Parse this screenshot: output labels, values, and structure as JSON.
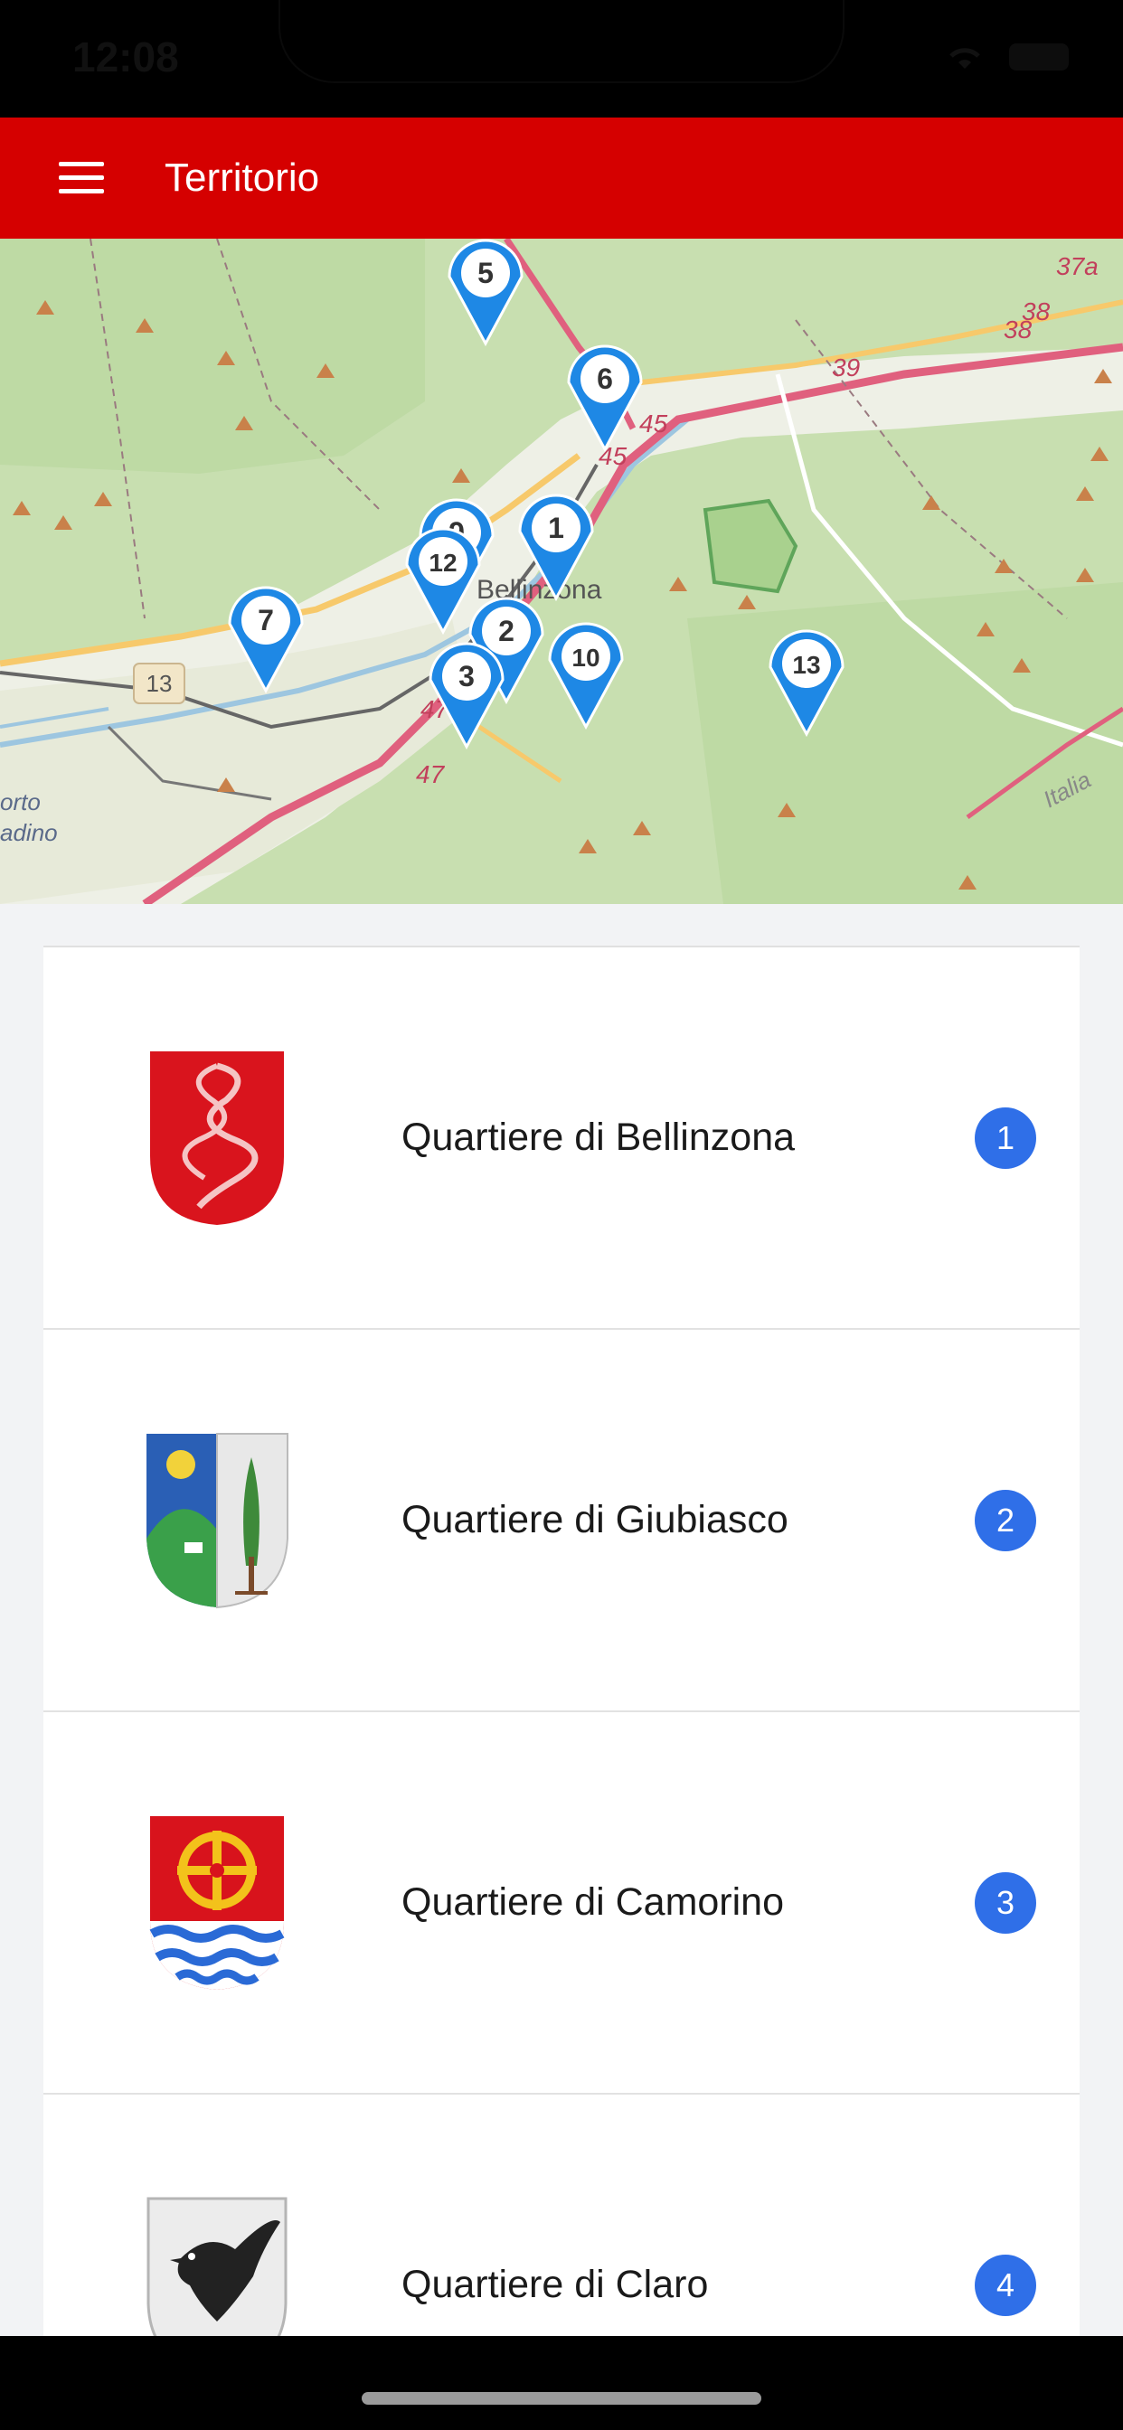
{
  "status_bar": {
    "time": "12:08"
  },
  "app_bar": {
    "title": "Territorio"
  },
  "map": {
    "labels": {
      "city": "Bellinzona",
      "road_13": "13",
      "road_45a": "45",
      "road_45b": "45",
      "road_47a": "47",
      "road_47b": "47",
      "road_39": "39",
      "road_38a": "38",
      "road_38b": "38",
      "road_37a": "37a",
      "italia": "Italia",
      "orto": "orto",
      "adino": "adino"
    },
    "markers": [
      "5",
      "6",
      "1",
      "9",
      "12",
      "7",
      "2",
      "10",
      "3",
      "13"
    ]
  },
  "list": {
    "items": [
      {
        "label": "Quartiere di Bellinzona",
        "badge": "1",
        "crest": "bellinzona-crest-icon"
      },
      {
        "label": "Quartiere di Giubiasco",
        "badge": "2",
        "crest": "giubiasco-crest-icon"
      },
      {
        "label": "Quartiere di Camorino",
        "badge": "3",
        "crest": "camorino-crest-icon"
      },
      {
        "label": "Quartiere di Claro",
        "badge": "4",
        "crest": "claro-crest-icon"
      }
    ]
  },
  "colors": {
    "app_bar": "#d50000",
    "badge": "#2f6fe8",
    "marker": "#1e88e5"
  }
}
